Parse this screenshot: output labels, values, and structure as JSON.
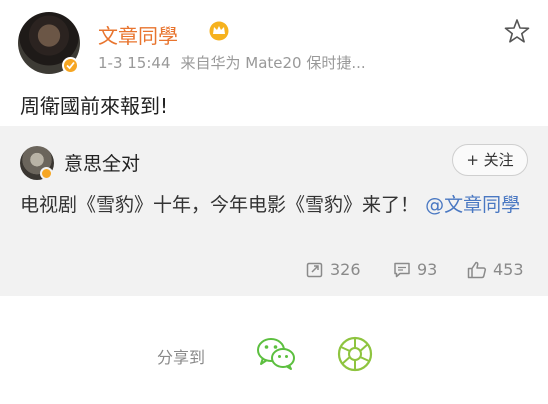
{
  "post": {
    "username": "文章同學",
    "timestamp": "1-3 15:44",
    "source": "来自华为 Mate20 保时捷...",
    "text": "周衛國前來報到!"
  },
  "quoted": {
    "username": "意思全对",
    "follow_label": "+ 关注",
    "text_main": "电视剧《雪豹》十年，今年电影《雪豹》来了！",
    "mention": "@文章同學",
    "stats": {
      "reposts": "326",
      "comments": "93",
      "likes": "453"
    }
  },
  "share": {
    "label": "分享到"
  },
  "colors": {
    "username": "#e8742e",
    "mention": "#4a78c2",
    "quote_bg": "#f2f2f2",
    "wechat": "#5cbf3f",
    "moments": "#8ec43f"
  },
  "icons": [
    "verified-badge-icon",
    "crown-icon",
    "chevron-down-icon",
    "repost-icon",
    "comment-icon",
    "like-icon",
    "wechat-icon",
    "moments-icon"
  ]
}
